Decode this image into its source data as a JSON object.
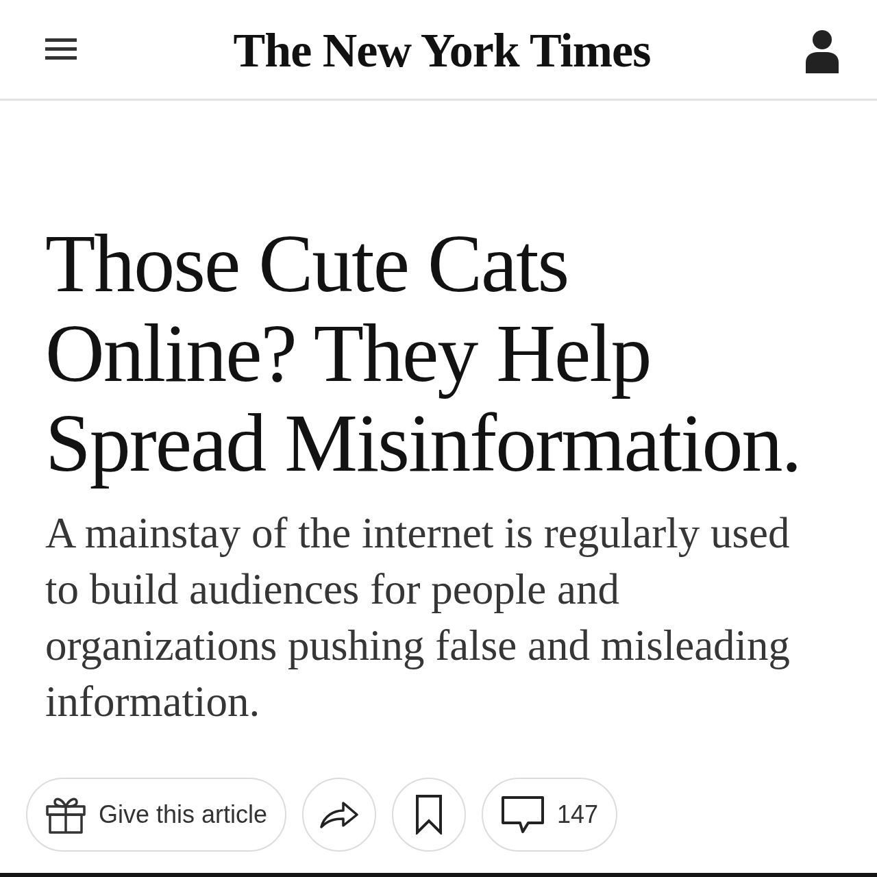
{
  "header": {
    "masthead": "The New York Times"
  },
  "article": {
    "headline": "Those Cute Cats Online? They Help Spread Misinformation.",
    "summary": "A mainstay of the internet is regularly used to build audiences for people and organizations pushing false and misleading information."
  },
  "actions": [
    {
      "kind": "gift",
      "label": "Give this article"
    },
    {
      "kind": "share"
    },
    {
      "kind": "bookmark"
    },
    {
      "kind": "comments",
      "label": "147"
    }
  ]
}
